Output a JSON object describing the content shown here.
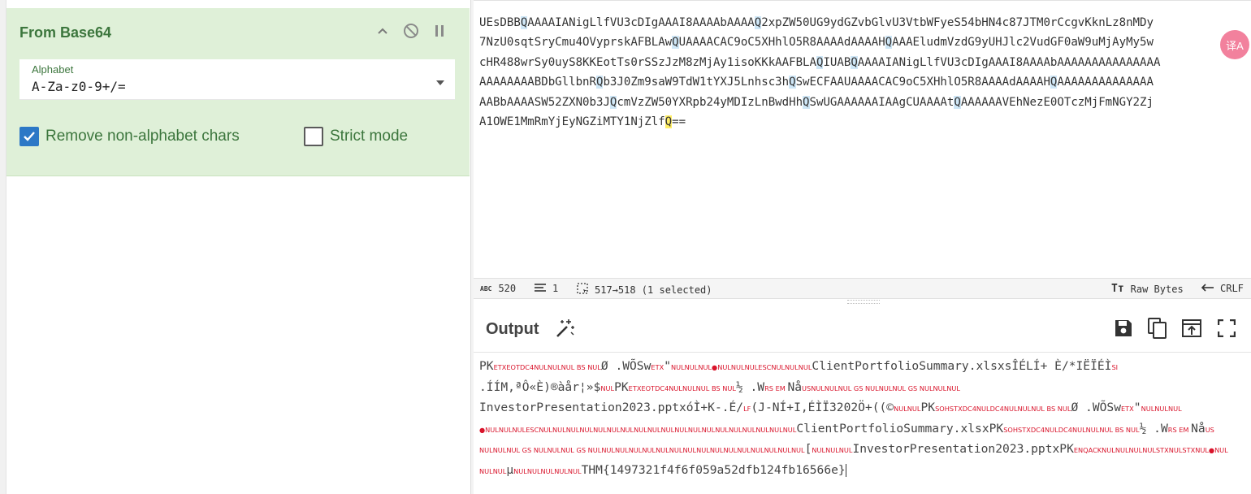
{
  "recipe": {
    "operation_title": "From Base64",
    "alphabet_label": "Alphabet",
    "alphabet_value": "A-Za-z0-9+/=",
    "remove_nonalpha_label": "Remove non-alphabet chars",
    "remove_nonalpha_checked": true,
    "strict_mode_label": "Strict mode",
    "strict_mode_checked": false
  },
  "input": {
    "lines": [
      "UEsDBBQAAAAIANigLlfVU3cDIgAAAI8AAAAbAAAAQ2xpZW50UG9ydGZvbGlvU3VtbWFyeS54bHN4c87JTM0rCcgvKknLz8nMDy",
      "7NzU0sqtSryCmu4OVyprskAFBLAwQUAAAACAC9oC5XHhlO5R8AAAAdAAAAHQAAAEludmVzdG9yUHJlc2VudGF0aW9uMjAyMy5w",
      "cHR488wrSy0uyS8KKEotTs0rSSzJzM8zMjAy1isoKKkAAFBLAQIUABQAAAAIANigLlfVU3cDIgAAAI8AAAAbAAAAAAAAAAAAAAA",
      "AAAAAAAABDbGllbnRQb3J0Zm9saW9TdW1tYXJ5Lnhsc3hQSwECFAAUAAAACAC9oC5XHhlO5R8AAAAdAAAAHQAAAAAAAAAAAAAA",
      "AABbAAAASW52ZXN0b3JQcmVzZW50YXRpb24yMDIzLnBwdHhQSwUGAAAAAAIAAgCUAAAAtQAAAAAAVEhNezE0OTczMjFmNGY2Zj",
      "A1OWE1MmRmYjEyNGZiMTY1NjZlfQ=="
    ],
    "badge": "译A"
  },
  "status": {
    "length": "520",
    "lines": "1",
    "selection": "517→518 (1 selected)",
    "encoding": "Raw Bytes",
    "eol": "CRLF"
  },
  "output": {
    "title": "Output",
    "lines": [
      [
        [
          "t",
          "PK"
        ],
        [
          "c",
          "ETX"
        ],
        [
          "c",
          "EOT"
        ],
        [
          "c",
          "DC4"
        ],
        [
          "c",
          "NUL"
        ],
        [
          "c",
          "NUL"
        ],
        [
          "c",
          "NUL"
        ],
        [
          "c",
          " BS "
        ],
        [
          "c",
          "NUL"
        ],
        [
          "t",
          "Ø .WÕSw"
        ],
        [
          "c",
          "ETX"
        ],
        [
          "t",
          "\""
        ],
        [
          "c",
          "NUL"
        ],
        [
          "c",
          "NUL"
        ],
        [
          "c",
          "NUL"
        ],
        [
          "c",
          "●"
        ],
        [
          "c",
          "NUL"
        ],
        [
          "c",
          "NUL"
        ],
        [
          "c",
          "NUL"
        ],
        [
          "c",
          "ESC"
        ],
        [
          "c",
          "NUL"
        ],
        [
          "c",
          "NUL"
        ],
        [
          "c",
          "NUL"
        ],
        [
          "t",
          "ClientPortfolioSummary.xlsxsÎÉLÍ+ È/*IËÏÉÌ"
        ],
        [
          "c",
          "SI"
        ]
      ],
      [
        [
          "t",
          ".ÍÍM,ªÔ«È)®àår¦»$"
        ],
        [
          "c",
          "NUL"
        ],
        [
          "t",
          "PK"
        ],
        [
          "c",
          "ETX"
        ],
        [
          "c",
          "EOT"
        ],
        [
          "c",
          "DC4"
        ],
        [
          "c",
          "NUL"
        ],
        [
          "c",
          "NUL"
        ],
        [
          "c",
          "NUL"
        ],
        [
          "c",
          " BS "
        ],
        [
          "c",
          "NUL"
        ],
        [
          "t",
          "½ .W"
        ],
        [
          "c",
          "RS"
        ],
        [
          "c",
          " EM "
        ],
        [
          "t",
          "Nå"
        ],
        [
          "c",
          "US"
        ],
        [
          "c",
          "NUL"
        ],
        [
          "c",
          "NUL"
        ],
        [
          "c",
          "NUL"
        ],
        [
          "c",
          " GS "
        ],
        [
          "c",
          "NUL"
        ],
        [
          "c",
          "NUL"
        ],
        [
          "c",
          "NUL"
        ],
        [
          "c",
          " GS "
        ],
        [
          "c",
          "NUL"
        ],
        [
          "c",
          "NUL"
        ],
        [
          "c",
          "NUL"
        ]
      ],
      [
        [
          "t",
          "InvestorPresentation2023.pptxóÌ+K-.É/"
        ],
        [
          "c",
          "LF"
        ],
        [
          "t",
          "(J-NÍ+I,ÉÌÏ3202Ö+((©"
        ],
        [
          "c",
          "NUL"
        ],
        [
          "c",
          "NUL"
        ],
        [
          "t",
          "PK"
        ],
        [
          "c",
          "SOH"
        ],
        [
          "c",
          "STX"
        ],
        [
          "c",
          "DC4"
        ],
        [
          "c",
          "NUL"
        ],
        [
          "c",
          "DC4"
        ],
        [
          "c",
          "NUL"
        ],
        [
          "c",
          "NUL"
        ],
        [
          "c",
          "NUL"
        ],
        [
          "c",
          " BS "
        ],
        [
          "c",
          "NUL"
        ],
        [
          "t",
          "Ø .WÕSw"
        ],
        [
          "c",
          "ETX"
        ],
        [
          "t",
          "\""
        ],
        [
          "c",
          "NUL"
        ],
        [
          "c",
          "NUL"
        ],
        [
          "c",
          "NUL"
        ]
      ],
      [
        [
          "c",
          "●"
        ],
        [
          "c",
          "NUL"
        ],
        [
          "c",
          "NUL"
        ],
        [
          "c",
          "NUL"
        ],
        [
          "c",
          "ESC"
        ],
        [
          "c",
          "NUL"
        ],
        [
          "c",
          "NUL"
        ],
        [
          "c",
          "NUL"
        ],
        [
          "c",
          "NUL"
        ],
        [
          "c",
          "NUL"
        ],
        [
          "c",
          "NUL"
        ],
        [
          "c",
          "NUL"
        ],
        [
          "c",
          "NUL"
        ],
        [
          "c",
          "NUL"
        ],
        [
          "c",
          "NUL"
        ],
        [
          "c",
          "NUL"
        ],
        [
          "c",
          "NUL"
        ],
        [
          "c",
          "NUL"
        ],
        [
          "c",
          "NUL"
        ],
        [
          "c",
          "NUL"
        ],
        [
          "c",
          "NUL"
        ],
        [
          "c",
          "NUL"
        ],
        [
          "c",
          "NUL"
        ],
        [
          "c",
          "NUL"
        ],
        [
          "t",
          "ClientPortfolioSummary.xlsxPK"
        ],
        [
          "c",
          "SOH"
        ],
        [
          "c",
          "STX"
        ],
        [
          "c",
          "DC4"
        ],
        [
          "c",
          "NUL"
        ],
        [
          "c",
          "DC4"
        ],
        [
          "c",
          "NUL"
        ],
        [
          "c",
          "NUL"
        ],
        [
          "c",
          "NUL"
        ],
        [
          "c",
          " BS "
        ],
        [
          "c",
          "NUL"
        ],
        [
          "t",
          "½ .W"
        ],
        [
          "c",
          "RS"
        ],
        [
          "c",
          " EM "
        ],
        [
          "t",
          "Nå"
        ],
        [
          "c",
          "US"
        ]
      ],
      [
        [
          "c",
          "NUL"
        ],
        [
          "c",
          "NUL"
        ],
        [
          "c",
          "NUL"
        ],
        [
          "c",
          " GS "
        ],
        [
          "c",
          "NUL"
        ],
        [
          "c",
          "NUL"
        ],
        [
          "c",
          "NUL"
        ],
        [
          "c",
          " GS "
        ],
        [
          "c",
          "NUL"
        ],
        [
          "c",
          "NUL"
        ],
        [
          "c",
          "NUL"
        ],
        [
          "c",
          "NUL"
        ],
        [
          "c",
          "NUL"
        ],
        [
          "c",
          "NUL"
        ],
        [
          "c",
          "NUL"
        ],
        [
          "c",
          "NUL"
        ],
        [
          "c",
          "NUL"
        ],
        [
          "c",
          "NUL"
        ],
        [
          "c",
          "NUL"
        ],
        [
          "c",
          "NUL"
        ],
        [
          "c",
          "NUL"
        ],
        [
          "c",
          "NUL"
        ],
        [
          "c",
          "NUL"
        ],
        [
          "c",
          "NUL"
        ],
        [
          "t",
          "["
        ],
        [
          "c",
          "NUL"
        ],
        [
          "c",
          "NUL"
        ],
        [
          "c",
          "NUL"
        ],
        [
          "t",
          "InvestorPresentation2023.pptxPK"
        ],
        [
          "c",
          "ENQ"
        ],
        [
          "c",
          "ACK"
        ],
        [
          "c",
          "NUL"
        ],
        [
          "c",
          "NUL"
        ],
        [
          "c",
          "NUL"
        ],
        [
          "c",
          "NUL"
        ],
        [
          "c",
          "STX"
        ],
        [
          "c",
          "NUL"
        ],
        [
          "c",
          "STX"
        ],
        [
          "c",
          "NUL"
        ],
        [
          "c",
          "●"
        ],
        [
          "c",
          "NUL"
        ]
      ],
      [
        [
          "c",
          "NUL"
        ],
        [
          "c",
          "NUL"
        ],
        [
          "t",
          "µ"
        ],
        [
          "c",
          "NUL"
        ],
        [
          "c",
          "NUL"
        ],
        [
          "c",
          "NUL"
        ],
        [
          "c",
          "NUL"
        ],
        [
          "c",
          "NUL"
        ],
        [
          "t",
          "THM{1497321f4f6f059a52dfb124fb16566e}"
        ]
      ]
    ]
  },
  "colors": {
    "recipe_bg": "#dff0d8",
    "recipe_text": "#3c763d",
    "checkbox_on": "#2c78c6",
    "control_char": "#d9142b",
    "match_highlight": "#cfe7f7",
    "selection_highlight": "#ffee66"
  },
  "icons": {
    "collapse": "chevron-up-icon",
    "disable": "disable-icon",
    "pause": "pause-icon",
    "dropdown": "caret-down-icon",
    "magic": "magic-wand-icon",
    "save": "save-icon",
    "copy": "copy-icon",
    "replace_input": "replace-input-icon",
    "maximise": "maximise-icon"
  }
}
